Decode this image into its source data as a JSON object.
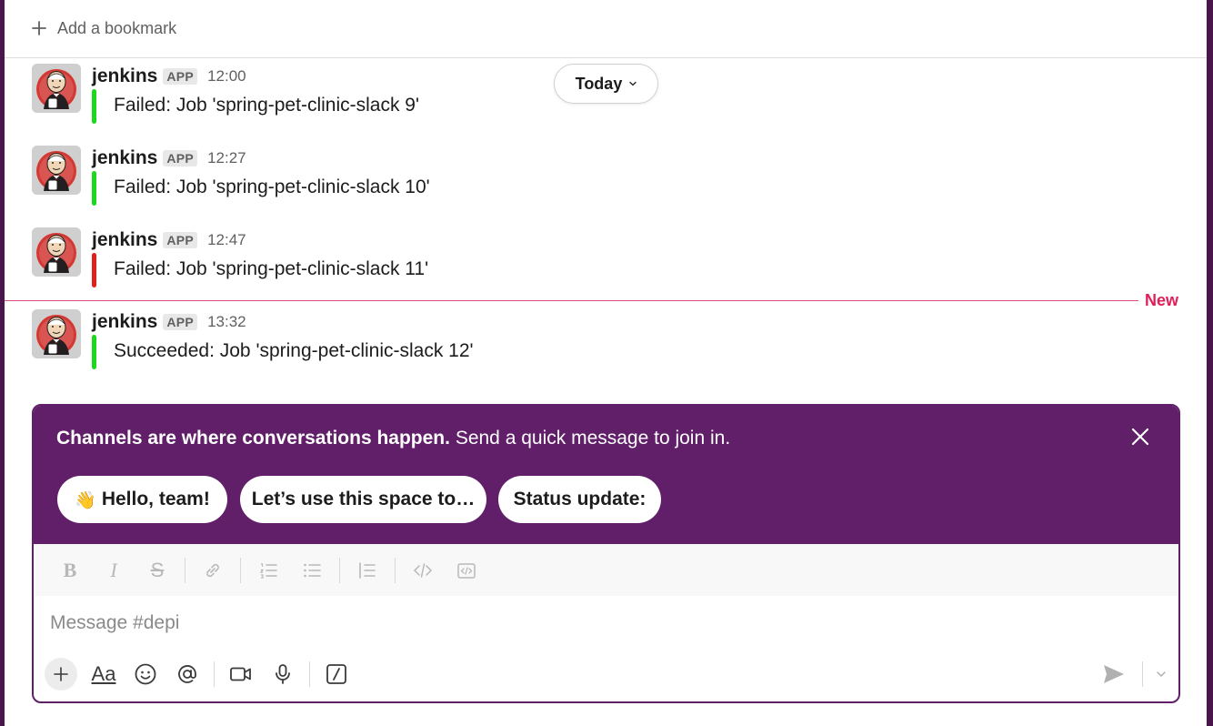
{
  "bookmarks": {
    "add_label": "Add a bookmark",
    "add_icon": "plus-icon"
  },
  "date_pill": {
    "label": "Today"
  },
  "messages": [
    {
      "sender": "jenkins",
      "badge": "APP",
      "time": "12:00",
      "text": "Failed: Job 'spring-pet-clinic-slack 9'",
      "bar_color": "#1ed81e"
    },
    {
      "sender": "jenkins",
      "badge": "APP",
      "time": "12:27",
      "text": "Failed: Job 'spring-pet-clinic-slack 10'",
      "bar_color": "#1ed81e"
    },
    {
      "sender": "jenkins",
      "badge": "APP",
      "time": "12:47",
      "text": "Failed: Job 'spring-pet-clinic-slack 11'",
      "bar_color": "#e01f1f"
    },
    {
      "sender": "jenkins",
      "badge": "APP",
      "time": "13:32",
      "text": "Succeeded: Job 'spring-pet-clinic-slack 12'",
      "bar_color": "#1ed81e"
    }
  ],
  "new_divider": {
    "label": "New",
    "color": "#e01e5a"
  },
  "promo": {
    "bold": "Channels are where conversations happen.",
    "rest": " Send a quick message to join in.",
    "background": "#611f69",
    "chips": [
      {
        "emoji": "👋",
        "label": "Hello, team!"
      },
      {
        "emoji": "",
        "label": "Let’s use this space to…"
      },
      {
        "emoji": "",
        "label": "Status update:"
      }
    ]
  },
  "formatting": {
    "bold": "B",
    "italic": "I",
    "strike": "S",
    "icons": [
      "bold-icon",
      "italic-icon",
      "strikethrough-icon",
      "link-icon",
      "ordered-list-icon",
      "bulleted-list-icon",
      "blockquote-icon",
      "code-icon",
      "code-block-icon"
    ]
  },
  "composer": {
    "placeholder": "Message #depi",
    "format_toggle": "Aa",
    "icons": [
      "plus-icon",
      "emoji-icon",
      "mention-icon",
      "video-icon",
      "microphone-icon",
      "slash-command-icon",
      "send-icon",
      "chevron-down-icon"
    ]
  }
}
